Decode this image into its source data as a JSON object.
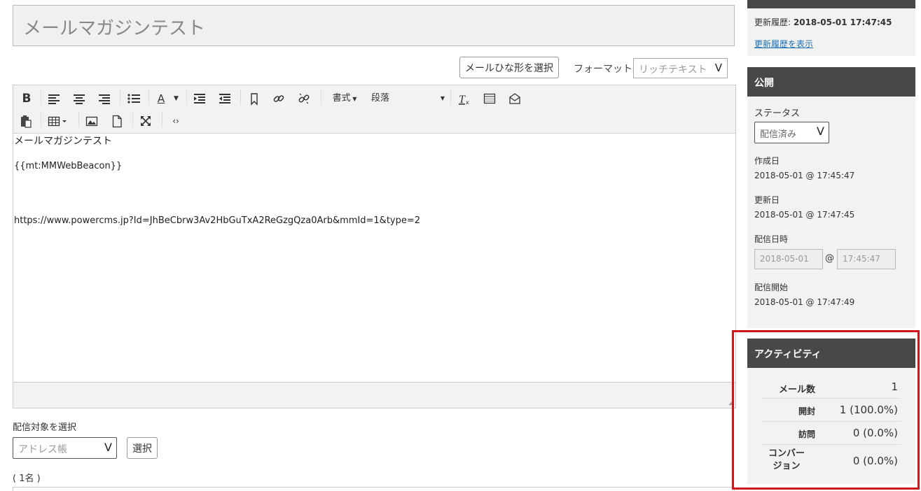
{
  "entry": {
    "title": "メールマガジンテスト",
    "template_button": "メールひな形を選択",
    "format_label": "フォーマット:",
    "format_value": "リッチテキスト"
  },
  "toolbar": {
    "bold_label": "B",
    "textcolor_label": "A",
    "style_dropdown": "書式",
    "paragraph_dropdown": "段落"
  },
  "editor": {
    "lines": [
      "メールマガジンテスト",
      "{{mt:MMWebBeacon}}",
      "https://www.powercms.jp?Id=JhBeCbrw3Av2HbGuTxA2ReGzgQza0Arb&mmId=1&type=2"
    ]
  },
  "recipients": {
    "label": "配信対象を選択",
    "select_value": "アドレス帳",
    "select_button": "選択",
    "count": "( 1名 )"
  },
  "sidebar": {
    "history_label": "更新履歴:",
    "history_value": "2018-05-01 17:47:45",
    "history_link": "更新履歴を表示",
    "publish": {
      "title": "公開",
      "status_label": "ステータス",
      "status_value": "配信済み",
      "created_label": "作成日",
      "created_value": "2018-05-01 @ 17:45:47",
      "modified_label": "更新日",
      "modified_value": "2018-05-01 @ 17:47:45",
      "delivery_label": "配信日時",
      "delivery_date": "2018-05-01",
      "delivery_at": "@",
      "delivery_time": "17:45:47",
      "start_label": "配信開始",
      "start_value": "2018-05-01 @ 17:47:49"
    },
    "activity": {
      "title": "アクティビティ",
      "rows": [
        {
          "label": "メール数",
          "value": "1"
        },
        {
          "label": "開封",
          "value": "1 (100.0%)"
        },
        {
          "label": "訪問",
          "value": "0 (0.0%)"
        },
        {
          "label": "コンバー\nジョン",
          "value": "0 (0.0%)"
        }
      ]
    }
  },
  "colors": {
    "panel_header": "#484848",
    "highlight_border": "#d0161d",
    "link": "#1a6fb5"
  }
}
